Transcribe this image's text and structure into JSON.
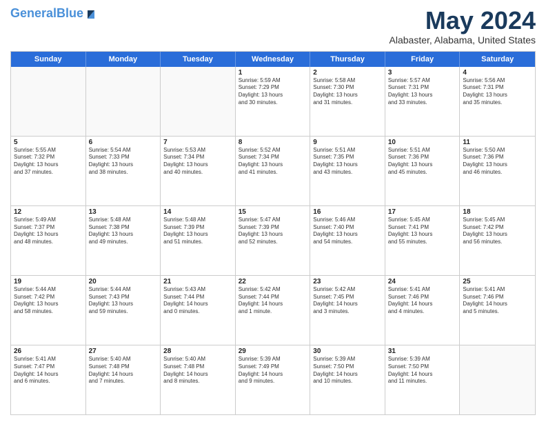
{
  "logo": {
    "line1": "General",
    "line2": "Blue"
  },
  "header": {
    "month": "May 2024",
    "location": "Alabaster, Alabama, United States"
  },
  "weekdays": [
    "Sunday",
    "Monday",
    "Tuesday",
    "Wednesday",
    "Thursday",
    "Friday",
    "Saturday"
  ],
  "weeks": [
    [
      {
        "day": "",
        "lines": []
      },
      {
        "day": "",
        "lines": []
      },
      {
        "day": "",
        "lines": []
      },
      {
        "day": "1",
        "lines": [
          "Sunrise: 5:59 AM",
          "Sunset: 7:29 PM",
          "Daylight: 13 hours",
          "and 30 minutes."
        ]
      },
      {
        "day": "2",
        "lines": [
          "Sunrise: 5:58 AM",
          "Sunset: 7:30 PM",
          "Daylight: 13 hours",
          "and 31 minutes."
        ]
      },
      {
        "day": "3",
        "lines": [
          "Sunrise: 5:57 AM",
          "Sunset: 7:31 PM",
          "Daylight: 13 hours",
          "and 33 minutes."
        ]
      },
      {
        "day": "4",
        "lines": [
          "Sunrise: 5:56 AM",
          "Sunset: 7:31 PM",
          "Daylight: 13 hours",
          "and 35 minutes."
        ]
      }
    ],
    [
      {
        "day": "5",
        "lines": [
          "Sunrise: 5:55 AM",
          "Sunset: 7:32 PM",
          "Daylight: 13 hours",
          "and 37 minutes."
        ]
      },
      {
        "day": "6",
        "lines": [
          "Sunrise: 5:54 AM",
          "Sunset: 7:33 PM",
          "Daylight: 13 hours",
          "and 38 minutes."
        ]
      },
      {
        "day": "7",
        "lines": [
          "Sunrise: 5:53 AM",
          "Sunset: 7:34 PM",
          "Daylight: 13 hours",
          "and 40 minutes."
        ]
      },
      {
        "day": "8",
        "lines": [
          "Sunrise: 5:52 AM",
          "Sunset: 7:34 PM",
          "Daylight: 13 hours",
          "and 41 minutes."
        ]
      },
      {
        "day": "9",
        "lines": [
          "Sunrise: 5:51 AM",
          "Sunset: 7:35 PM",
          "Daylight: 13 hours",
          "and 43 minutes."
        ]
      },
      {
        "day": "10",
        "lines": [
          "Sunrise: 5:51 AM",
          "Sunset: 7:36 PM",
          "Daylight: 13 hours",
          "and 45 minutes."
        ]
      },
      {
        "day": "11",
        "lines": [
          "Sunrise: 5:50 AM",
          "Sunset: 7:36 PM",
          "Daylight: 13 hours",
          "and 46 minutes."
        ]
      }
    ],
    [
      {
        "day": "12",
        "lines": [
          "Sunrise: 5:49 AM",
          "Sunset: 7:37 PM",
          "Daylight: 13 hours",
          "and 48 minutes."
        ]
      },
      {
        "day": "13",
        "lines": [
          "Sunrise: 5:48 AM",
          "Sunset: 7:38 PM",
          "Daylight: 13 hours",
          "and 49 minutes."
        ]
      },
      {
        "day": "14",
        "lines": [
          "Sunrise: 5:48 AM",
          "Sunset: 7:39 PM",
          "Daylight: 13 hours",
          "and 51 minutes."
        ]
      },
      {
        "day": "15",
        "lines": [
          "Sunrise: 5:47 AM",
          "Sunset: 7:39 PM",
          "Daylight: 13 hours",
          "and 52 minutes."
        ]
      },
      {
        "day": "16",
        "lines": [
          "Sunrise: 5:46 AM",
          "Sunset: 7:40 PM",
          "Daylight: 13 hours",
          "and 54 minutes."
        ]
      },
      {
        "day": "17",
        "lines": [
          "Sunrise: 5:45 AM",
          "Sunset: 7:41 PM",
          "Daylight: 13 hours",
          "and 55 minutes."
        ]
      },
      {
        "day": "18",
        "lines": [
          "Sunrise: 5:45 AM",
          "Sunset: 7:42 PM",
          "Daylight: 13 hours",
          "and 56 minutes."
        ]
      }
    ],
    [
      {
        "day": "19",
        "lines": [
          "Sunrise: 5:44 AM",
          "Sunset: 7:42 PM",
          "Daylight: 13 hours",
          "and 58 minutes."
        ]
      },
      {
        "day": "20",
        "lines": [
          "Sunrise: 5:44 AM",
          "Sunset: 7:43 PM",
          "Daylight: 13 hours",
          "and 59 minutes."
        ]
      },
      {
        "day": "21",
        "lines": [
          "Sunrise: 5:43 AM",
          "Sunset: 7:44 PM",
          "Daylight: 14 hours",
          "and 0 minutes."
        ]
      },
      {
        "day": "22",
        "lines": [
          "Sunrise: 5:42 AM",
          "Sunset: 7:44 PM",
          "Daylight: 14 hours",
          "and 1 minute."
        ]
      },
      {
        "day": "23",
        "lines": [
          "Sunrise: 5:42 AM",
          "Sunset: 7:45 PM",
          "Daylight: 14 hours",
          "and 3 minutes."
        ]
      },
      {
        "day": "24",
        "lines": [
          "Sunrise: 5:41 AM",
          "Sunset: 7:46 PM",
          "Daylight: 14 hours",
          "and 4 minutes."
        ]
      },
      {
        "day": "25",
        "lines": [
          "Sunrise: 5:41 AM",
          "Sunset: 7:46 PM",
          "Daylight: 14 hours",
          "and 5 minutes."
        ]
      }
    ],
    [
      {
        "day": "26",
        "lines": [
          "Sunrise: 5:41 AM",
          "Sunset: 7:47 PM",
          "Daylight: 14 hours",
          "and 6 minutes."
        ]
      },
      {
        "day": "27",
        "lines": [
          "Sunrise: 5:40 AM",
          "Sunset: 7:48 PM",
          "Daylight: 14 hours",
          "and 7 minutes."
        ]
      },
      {
        "day": "28",
        "lines": [
          "Sunrise: 5:40 AM",
          "Sunset: 7:48 PM",
          "Daylight: 14 hours",
          "and 8 minutes."
        ]
      },
      {
        "day": "29",
        "lines": [
          "Sunrise: 5:39 AM",
          "Sunset: 7:49 PM",
          "Daylight: 14 hours",
          "and 9 minutes."
        ]
      },
      {
        "day": "30",
        "lines": [
          "Sunrise: 5:39 AM",
          "Sunset: 7:50 PM",
          "Daylight: 14 hours",
          "and 10 minutes."
        ]
      },
      {
        "day": "31",
        "lines": [
          "Sunrise: 5:39 AM",
          "Sunset: 7:50 PM",
          "Daylight: 14 hours",
          "and 11 minutes."
        ]
      },
      {
        "day": "",
        "lines": []
      }
    ]
  ]
}
